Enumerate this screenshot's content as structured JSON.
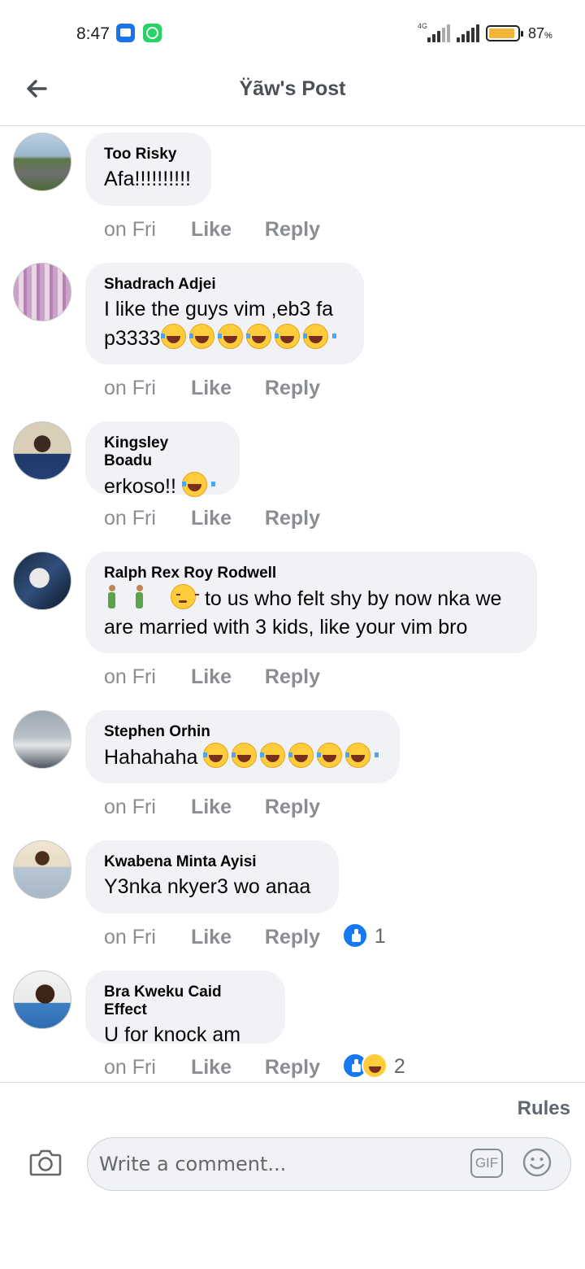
{
  "status_bar": {
    "time": "8:47",
    "network": "4G",
    "battery": "87",
    "battery_unit": "%",
    "battery_fill_percent": 87,
    "battery_color": "#f4b63a"
  },
  "header": {
    "title": "Ÿãw's Post",
    "back_icon": "arrow-left-icon"
  },
  "comments": [
    {
      "author": "Too Risky",
      "text": "Afa!!!!!!!!!!",
      "time": "on Fri",
      "like": "Like",
      "reply": "Reply"
    },
    {
      "author": "Shadrach Adjei",
      "text": "I like the guys vim ,eb3 fa",
      "text2": "p3333",
      "time": "on Fri",
      "like": "Like",
      "reply": "Reply"
    },
    {
      "author": "Kingsley Boadu",
      "text": "erkoso!!",
      "time": "on Fri",
      "like": "Like",
      "reply": "Reply"
    },
    {
      "author": "Ralph Rex Roy Rodwell",
      "text": "to us who felt shy by now nka we",
      "text2": "are married with 3 kids, like your vim bro",
      "time": "on Fri",
      "like": "Like",
      "reply": "Reply"
    },
    {
      "author": "Stephen Orhin",
      "text": "Hahahaha",
      "time": "on Fri",
      "like": "Like",
      "reply": "Reply"
    },
    {
      "author": "Kwabena Minta Ayisi",
      "text": "Y3nka nkyer3 wo anaa",
      "time": "on Fri",
      "like": "Like",
      "reply": "Reply",
      "reaction_count": "1"
    },
    {
      "author": "Bra Kweku Caid Effect",
      "text": "U for knock am",
      "time": "on Fri",
      "like": "Like",
      "reply": "Reply",
      "reaction_count": "2"
    }
  ],
  "footer": {
    "rules": "Rules",
    "placeholder": "Write a comment...",
    "gif": "GIF"
  },
  "colors": {
    "bubble": "#f0f2f5",
    "action_text": "#8a8d91",
    "like_reaction": "#1877f2"
  }
}
